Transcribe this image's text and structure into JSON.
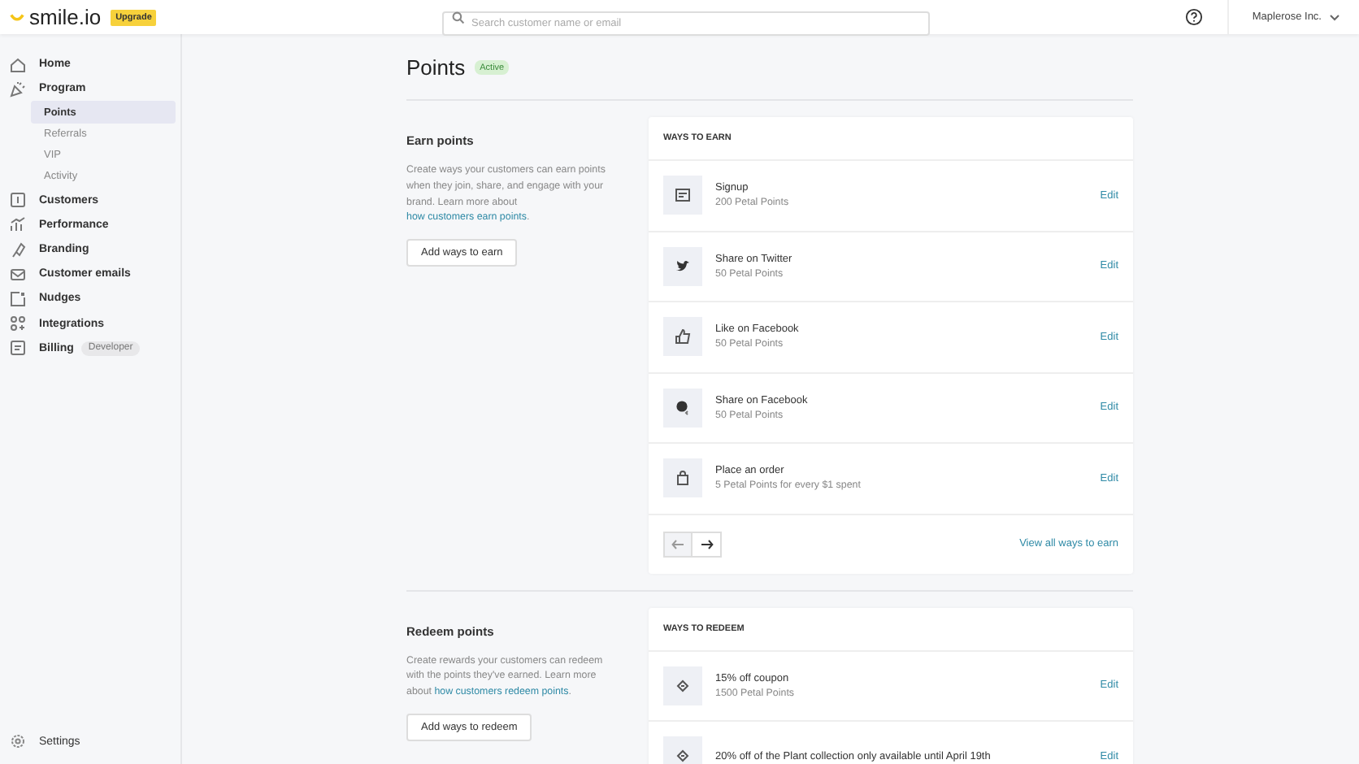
{
  "topbar": {
    "logo": "smile.io",
    "upgrade_badge": "Upgrade",
    "search": {
      "placeholder": "Search customer name or email"
    },
    "account": "Maplerose Inc."
  },
  "sidebar": {
    "items": [
      {
        "label": "Home",
        "kind": "home",
        "selected": false
      },
      {
        "label": "Program",
        "kind": "program",
        "selected": false,
        "children": [
          {
            "label": "Points",
            "selected": true
          },
          {
            "label": "Referrals",
            "selected": false
          },
          {
            "label": "VIP",
            "selected": false
          },
          {
            "label": "Activity",
            "selected": false
          }
        ]
      },
      {
        "label": "Customers",
        "kind": "customers",
        "selected": false
      },
      {
        "label": "Performance",
        "kind": "performance",
        "selected": false
      },
      {
        "label": "Branding",
        "kind": "branding",
        "selected": false
      },
      {
        "label": "Customer emails",
        "kind": "email",
        "selected": false
      },
      {
        "label": "Nudges",
        "kind": "nudges",
        "selected": false
      },
      {
        "label": "Integrations",
        "kind": "integrations",
        "selected": false
      },
      {
        "label": "Billing",
        "kind": "billing",
        "selected": false,
        "badge": "Developer"
      }
    ],
    "settings": "Settings"
  },
  "page": {
    "title": "Points",
    "status": "Active"
  },
  "sections": [
    {
      "heading": "Earn points",
      "description": "Create ways your customers can earn points when they join, share, and engage with your brand. Learn more about ",
      "link": "how customers earn points",
      "after": ".",
      "button": "Add ways to earn",
      "card_title": "WAYS TO EARN",
      "items": [
        {
          "kind": "signup",
          "title": "Signup",
          "subtitle": "200 Petal Points",
          "action": "Edit"
        },
        {
          "kind": "twitter",
          "title": "Share on Twitter",
          "subtitle": "50 Petal Points",
          "action": "Edit"
        },
        {
          "kind": "like",
          "title": "Like on Facebook",
          "subtitle": "50 Petal Points",
          "action": "Edit"
        },
        {
          "kind": "facebook",
          "title": "Share on Facebook",
          "subtitle": "50 Petal Points",
          "action": "Edit"
        },
        {
          "kind": "order",
          "title": "Place an order",
          "subtitle": "5 Petal Points for every $1 spent",
          "action": "Edit"
        }
      ],
      "pager": {
        "prev_disabled": true,
        "next_disabled": false
      },
      "view_all": "View all ways to earn"
    },
    {
      "heading": "Redeem points",
      "description": "Create rewards your customers can redeem with the points they've earned. Learn more about ",
      "link": "how customers redeem points",
      "after": ".",
      "button": "Add ways to redeem",
      "card_title": "WAYS TO REDEEM",
      "items": [
        {
          "kind": "coupon",
          "title": "15% off coupon",
          "subtitle": "1500 Petal Points",
          "action": "Edit"
        },
        {
          "kind": "coupon",
          "title": "20% off of the Plant collection only available until April 19th",
          "action": "Edit"
        }
      ]
    }
  ]
}
